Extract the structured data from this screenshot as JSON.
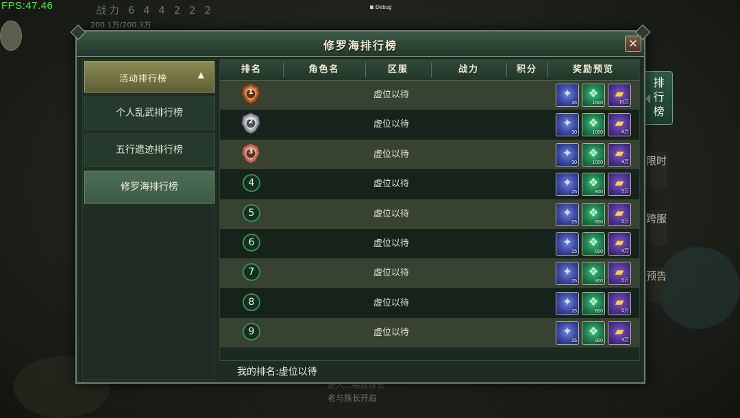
{
  "hud": {
    "fps": "FPS:47.46",
    "debug": "Debug"
  },
  "background": {
    "power": "战力 6 4 4 2 2 2",
    "hp": "200.1万/200.3万",
    "bottom_line1": "进入...每周族长",
    "bottom_line2": "老与族长开启",
    "right_tabs": [
      "限时",
      "跨服",
      "预告"
    ]
  },
  "dialog": {
    "title": "修罗海排行榜",
    "close_label": "✕"
  },
  "sidebar": {
    "header": "活动排行榜",
    "items": [
      {
        "label": "个人乱武排行榜",
        "active": false
      },
      {
        "label": "五行遗迹排行榜",
        "active": false
      },
      {
        "label": "修罗海排行榜",
        "active": true
      }
    ]
  },
  "table": {
    "columns": [
      "排名",
      "角色名",
      "区服",
      "战力",
      "积分",
      "奖励预览"
    ],
    "rows": [
      {
        "rank": "1",
        "name": "虚位以待",
        "rewards": [
          "35",
          "1500",
          "10万"
        ]
      },
      {
        "rank": "2",
        "name": "虚位以待",
        "rewards": [
          "30",
          "1000",
          "8万"
        ]
      },
      {
        "rank": "3",
        "name": "虚位以待",
        "rewards": [
          "30",
          "1000",
          "8万"
        ]
      },
      {
        "rank": "4",
        "name": "虚位以待",
        "rewards": [
          "25",
          "800",
          "5万"
        ]
      },
      {
        "rank": "5",
        "name": "虚位以待",
        "rewards": [
          "25",
          "800",
          "5万"
        ]
      },
      {
        "rank": "6",
        "name": "虚位以待",
        "rewards": [
          "25",
          "800",
          "5万"
        ]
      },
      {
        "rank": "7",
        "name": "虚位以待",
        "rewards": [
          "25",
          "800",
          "5万"
        ]
      },
      {
        "rank": "8",
        "name": "虚位以待",
        "rewards": [
          "25",
          "800",
          "5万"
        ]
      },
      {
        "rank": "9",
        "name": "虚位以待",
        "rewards": [
          "25",
          "800",
          "5万"
        ]
      }
    ]
  },
  "my_rank": "我的排名:虚位以待",
  "side_tab": "排行榜",
  "icons": {
    "medal_gold": "gold-medal-icon",
    "medal_silver": "silver-medal-icon",
    "medal_bronze": "bronze-medal-icon",
    "reward_1": "blue-orb-icon",
    "reward_2": "green-jade-icon",
    "reward_3": "gold-ticket-icon"
  },
  "colors": {
    "fps": "#3dff2c",
    "title_bar": "#3b5a46",
    "active_tab": "#4c6d56",
    "header_tab": "#8a8a52"
  }
}
